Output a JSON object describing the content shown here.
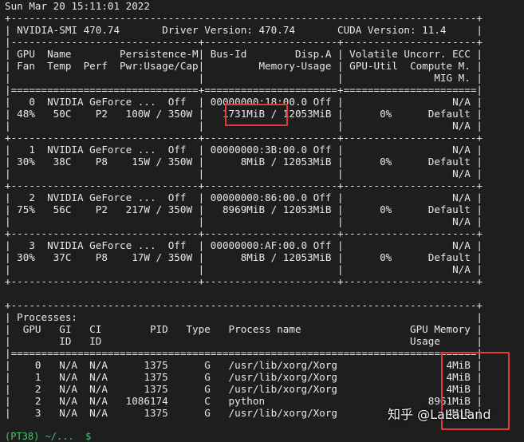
{
  "terminal": {
    "lines": [
      "Sun Mar 20 15:11:01 2022",
      "+-----------------------------------------------------------------------------+",
      "| NVIDIA-SMI 470.74       Driver Version: 470.74       CUDA Version: 11.4     |",
      "|-------------------------------+----------------------+----------------------+",
      "| GPU  Name        Persistence-M| Bus-Id        Disp.A | Volatile Uncorr. ECC |",
      "| Fan  Temp  Perf  Pwr:Usage/Cap|         Memory-Usage | GPU-Util  Compute M. |",
      "|                               |                      |               MIG M. |",
      "|===============================+======================+======================|",
      "|   0  NVIDIA GeForce ...  Off  | 00000000:18:00.0 Off |                  N/A |",
      "| 48%   50C    P2   100W / 350W |   1731MiB / 12053MiB |      0%      Default |",
      "|                               |                      |                  N/A |",
      "+-------------------------------+----------------------+----------------------+",
      "|   1  NVIDIA GeForce ...  Off  | 00000000:3B:00.0 Off |                  N/A |",
      "| 30%   38C    P8    15W / 350W |      8MiB / 12053MiB |      0%      Default |",
      "|                               |                      |                  N/A |",
      "+-------------------------------+----------------------+----------------------+",
      "|   2  NVIDIA GeForce ...  Off  | 00000000:86:00.0 Off |                  N/A |",
      "| 75%   56C    P2   217W / 350W |   8969MiB / 12053MiB |      0%      Default |",
      "|                               |                      |                  N/A |",
      "+-------------------------------+----------------------+----------------------+",
      "|   3  NVIDIA GeForce ...  Off  | 00000000:AF:00.0 Off |                  N/A |",
      "| 30%   37C    P8    17W / 350W |      8MiB / 12053MiB |      0%      Default |",
      "|                               |                      |                  N/A |",
      "+-------------------------------+----------------------+----------------------+",
      "",
      "+-----------------------------------------------------------------------------+",
      "| Processes:                                                                  |",
      "|  GPU   GI   CI        PID   Type   Process name                  GPU Memory |",
      "|        ID   ID                                                   Usage      |",
      "|=============================================================================|",
      "|    0   N/A  N/A      1375      G   /usr/lib/xorg/Xorg                  4MiB |",
      "|    1   N/A  N/A      1375      G   /usr/lib/xorg/Xorg                  4MiB |",
      "|    2   N/A  N/A      1375      G   /usr/lib/xorg/Xorg                  4MiB |",
      "|    2   N/A  N/A   1086174      C   python                           8961MiB |",
      "|    3   N/A  N/A      1375      G   /usr/lib/xorg/Xorg                  4MiB |"
    ],
    "prompt_fragment": "(PT38) ~/...  $"
  },
  "watermark": "知乎 @LaLaLand",
  "colors": {
    "background": "#1e1e1e",
    "text": "#e8e8e8",
    "highlight": "#e03b3b",
    "prompt": "#4cc36a"
  }
}
